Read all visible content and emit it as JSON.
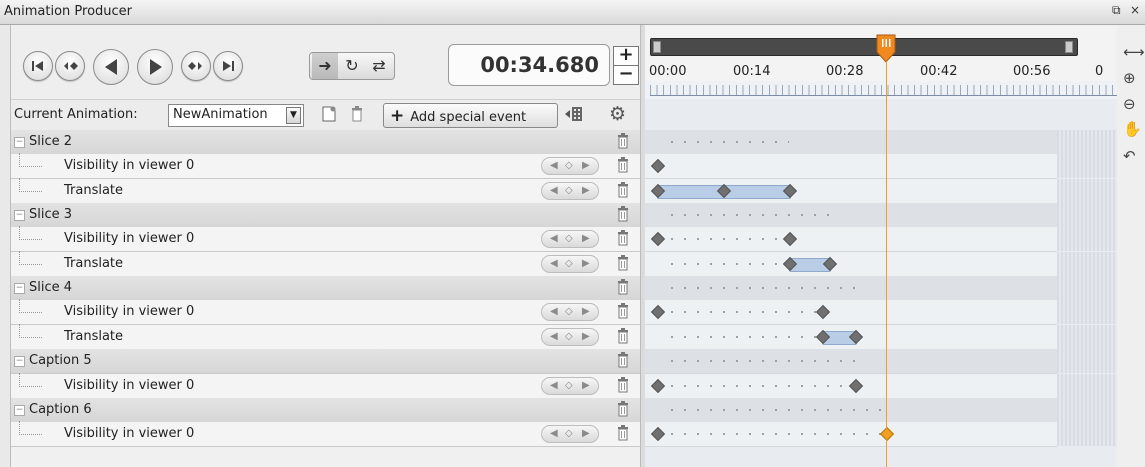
{
  "window": {
    "title": "Animation Producer",
    "restore_glyph": "⧉",
    "close_glyph": "×"
  },
  "transport": {
    "buttons": [
      "go-to-start-icon",
      "previous-keyframe-icon",
      "play-backward-icon",
      "play-forward-icon",
      "next-keyframe-icon",
      "go-to-end-icon"
    ],
    "play_modes": [
      "play-once-icon",
      "loop-icon",
      "swing-icon"
    ],
    "selected_mode": "play-once-icon",
    "current_time": "00:34.680",
    "increment": "+",
    "decrement": "−"
  },
  "controls": {
    "current_animation_label": "Current Animation:",
    "animation_name": "NewAnimation",
    "add_event_plus": "+",
    "add_event_label": "Add special event"
  },
  "tracks": [
    {
      "name": "Slice 2",
      "type": "group"
    },
    {
      "name": "Visibility in viewer 0",
      "type": "child"
    },
    {
      "name": "Translate",
      "type": "child"
    },
    {
      "name": "Slice 3",
      "type": "group"
    },
    {
      "name": "Visibility in viewer 0",
      "type": "child"
    },
    {
      "name": "Translate",
      "type": "child"
    },
    {
      "name": "Slice 4",
      "type": "group"
    },
    {
      "name": "Visibility in viewer 0",
      "type": "child"
    },
    {
      "name": "Translate",
      "type": "child"
    },
    {
      "name": "Caption 5",
      "type": "group"
    },
    {
      "name": "Visibility in viewer 0",
      "type": "child"
    },
    {
      "name": "Caption 6",
      "type": "group"
    },
    {
      "name": "Visibility in viewer 0",
      "type": "child"
    }
  ],
  "timeline": {
    "ticks": [
      "00:00",
      "00:14",
      "00:28",
      "00:42",
      "00:56",
      "0"
    ],
    "playhead_seconds": 34.68,
    "visible_range_seconds": [
      0,
      70
    ],
    "keyframes": {
      "1": [
        0
      ],
      "2": [
        0,
        10,
        20
      ],
      "4": [
        0,
        20
      ],
      "5": [
        20,
        26
      ],
      "7": [
        0,
        25
      ],
      "8": [
        25,
        30
      ],
      "10": [
        0,
        30
      ],
      "12": [
        0,
        34.68
      ]
    },
    "segments": {
      "2": [
        [
          0,
          20
        ]
      ],
      "5": [
        [
          20,
          26
        ]
      ],
      "8": [
        [
          25,
          30
        ]
      ]
    }
  },
  "side_tools": [
    "fit-range-icon",
    "zoom-in-icon",
    "zoom-out-icon",
    "pan-hand-icon",
    "undo-icon"
  ],
  "colors": {
    "playhead": "#f0a020",
    "keyframe": "#707070",
    "segment": "#b9cde6"
  }
}
